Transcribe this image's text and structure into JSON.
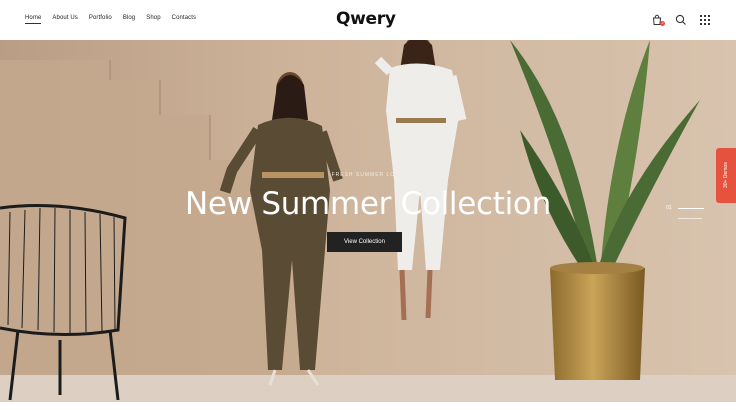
{
  "nav": {
    "items": [
      "Home",
      "About Us",
      "Portfolio",
      "Blog",
      "Shop",
      "Contacts"
    ],
    "active": "Home"
  },
  "brand": {
    "logo": "Qwery"
  },
  "header_icons": {
    "cart_icon": "cart-icon",
    "cart_count": "0",
    "search_icon": "search-icon",
    "menu_icon": "grid-menu-icon"
  },
  "hero": {
    "kicker": "FRESH SUMMER LOOK",
    "title": "New Summer Collection",
    "cta_label": "View Collection",
    "slide_number": "01"
  },
  "side_tab": {
    "label": "30+ Demos"
  },
  "colors": {
    "accent": "#e5533f",
    "button": "#222222",
    "wall": "#c8ad93"
  }
}
